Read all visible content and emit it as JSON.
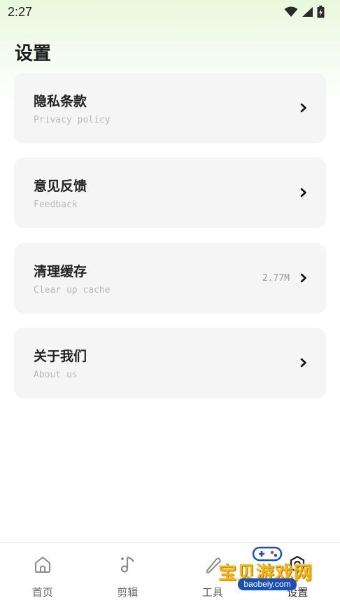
{
  "status_bar": {
    "time": "2:27"
  },
  "header": {
    "title": "设置"
  },
  "settings": [
    {
      "title": "隐私条款",
      "subtitle": "Privacy policy",
      "value": ""
    },
    {
      "title": "意见反馈",
      "subtitle": "Feedback",
      "value": ""
    },
    {
      "title": "清理缓存",
      "subtitle": "Clear up cache",
      "value": "2.77M"
    },
    {
      "title": "关于我们",
      "subtitle": "About us",
      "value": ""
    }
  ],
  "bottom_nav": [
    {
      "label": "首页",
      "icon": "home-icon"
    },
    {
      "label": "剪辑",
      "icon": "music-note-icon"
    },
    {
      "label": "工具",
      "icon": "tools-icon"
    },
    {
      "label": "设置",
      "icon": "settings-icon",
      "active": true
    }
  ],
  "watermark": {
    "text": "宝贝游戏网",
    "url": "baobeiy.com"
  },
  "colors": {
    "card_bg": "#f5f5f5",
    "gradient_top": "#e8f8dc",
    "watermark": "#f5b31a"
  }
}
